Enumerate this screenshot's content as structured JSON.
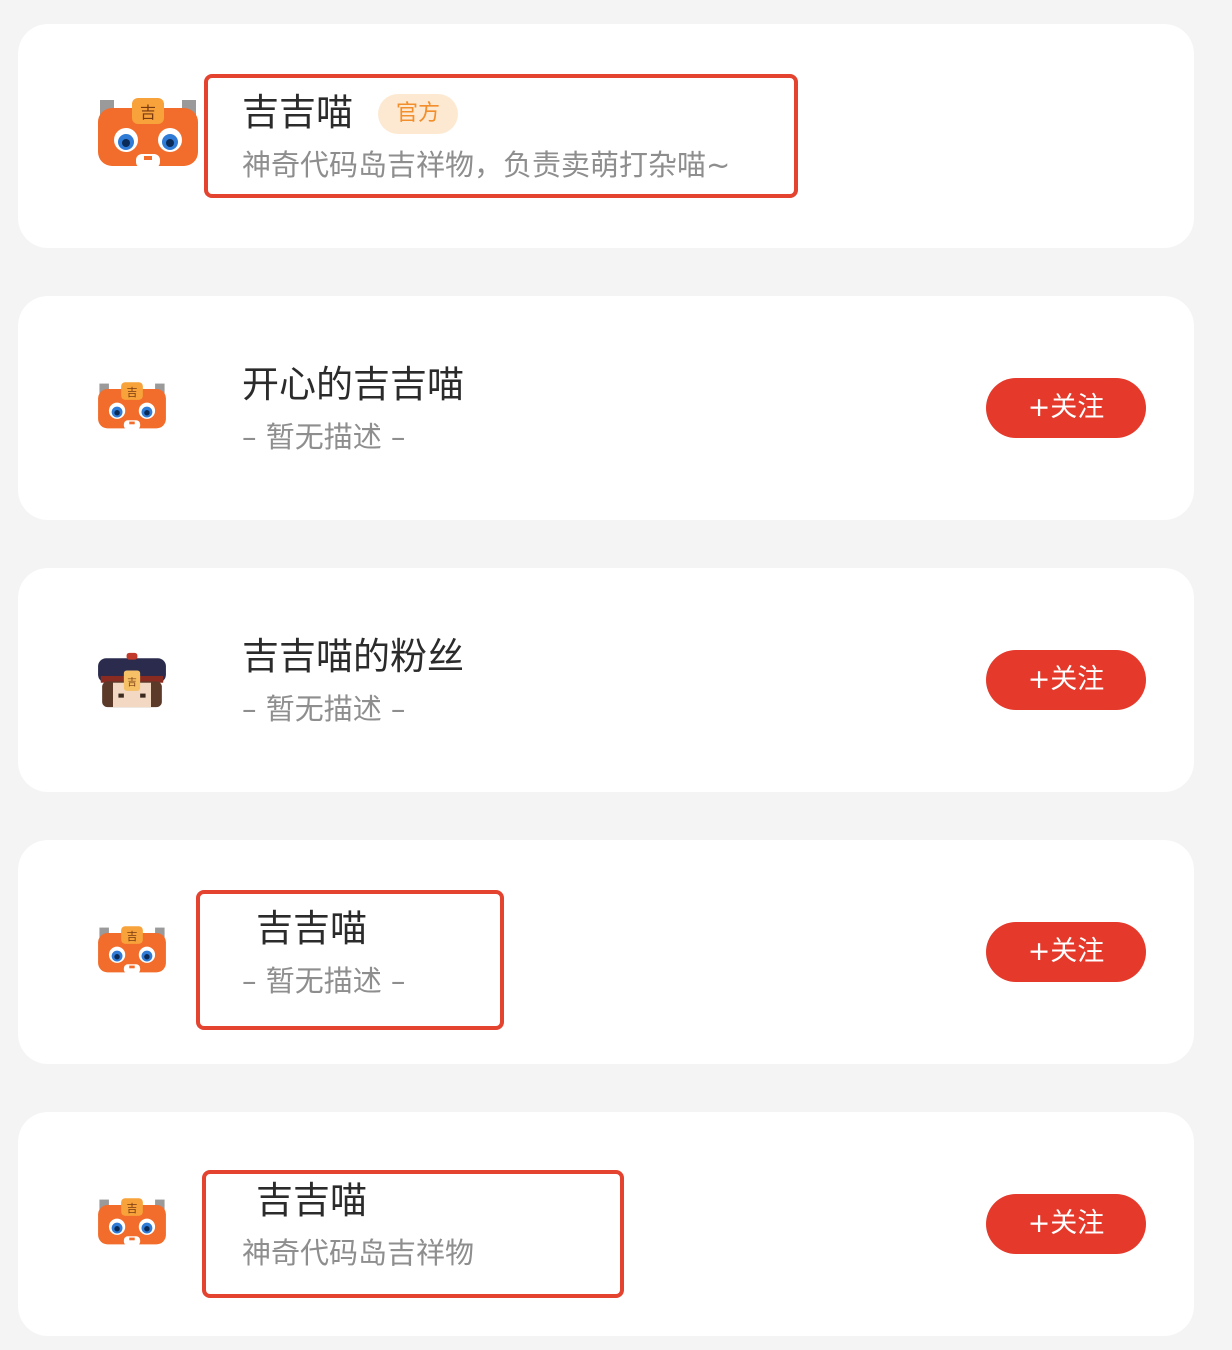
{
  "accounts": [
    {
      "name": "吉吉喵",
      "badge": "官方",
      "description": "神奇代码岛吉祥物，负责卖萌打杂喵~",
      "avatar": "orange-cat-avatar-icon"
    },
    {
      "name": "开心的吉吉喵",
      "description": "– 暂无描述 –",
      "follow_label": "+关注",
      "avatar": "orange-cat-avatar-icon"
    },
    {
      "name": "吉吉喵的粉丝",
      "description": "– 暂无描述 –",
      "follow_label": "+关注",
      "avatar": "hat-girl-avatar-icon"
    },
    {
      "name": "吉吉喵",
      "description": "– 暂无描述 –",
      "follow_label": "+关注",
      "avatar": "orange-cat-avatar-icon"
    },
    {
      "name": "吉吉喵",
      "description": "神奇代码岛吉祥物",
      "follow_label": "+关注",
      "avatar": "orange-cat-avatar-icon"
    }
  ],
  "colors": {
    "follow_button": "#e5392b",
    "badge_bg": "#fde9d2",
    "badge_text": "#f28e2b",
    "highlight_box": "#e3432f"
  }
}
